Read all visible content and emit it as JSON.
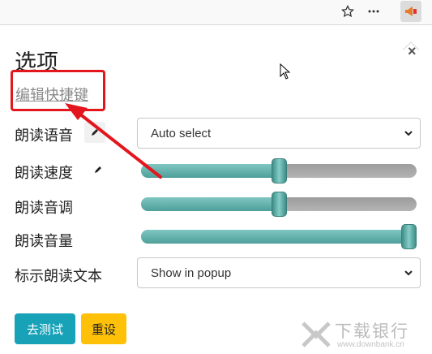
{
  "panel": {
    "title": "选项",
    "close_label": "×",
    "shortcut_link": "编辑快捷键"
  },
  "settings": {
    "voice_label": "朗读语音",
    "voice_value": "Auto select",
    "rate_label": "朗读速度",
    "rate_level": 0.5,
    "pitch_label": "朗读音调",
    "pitch_level": 0.5,
    "volume_label": "朗读音量",
    "volume_level": 1.0,
    "highlight_label": "标示朗读文本",
    "highlight_value": "Show in popup"
  },
  "buttons": {
    "test_label": "去测试",
    "reset_label": "重设"
  },
  "watermark": {
    "brand": "下载银行",
    "url": "www.downbank.cn"
  },
  "colors": {
    "accent": "#17a2b8",
    "warning": "#ffc107",
    "annotation": "#e3161d",
    "slider_fill": "#5fb0ab"
  }
}
